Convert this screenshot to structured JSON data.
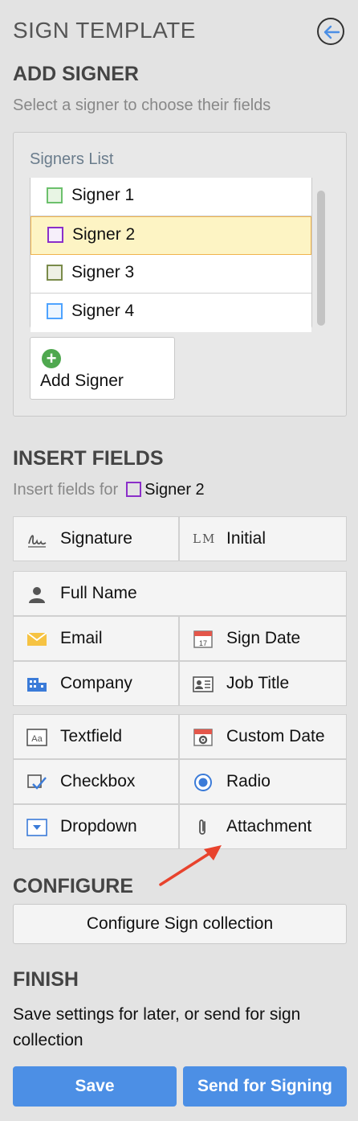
{
  "header": {
    "title": "SIGN TEMPLATE",
    "back_icon": "back-arrow-icon"
  },
  "add_signer": {
    "heading": "ADD SIGNER",
    "subtitle": "Select a signer to choose their fields",
    "list_label": "Signers List",
    "signers": [
      {
        "name": "Signer 1",
        "color": "#6cc06c"
      },
      {
        "name": "Signer 2",
        "color": "#8b2fc9",
        "selected": true
      },
      {
        "name": "Signer 3",
        "color": "#7a8b4a"
      },
      {
        "name": "Signer 4",
        "color": "#4ea3ff"
      }
    ],
    "add_button_label": "Add Signer"
  },
  "insert_fields": {
    "heading": "INSERT FIELDS",
    "insert_for_prefix": "Insert fields for",
    "current_signer": "Signer 2",
    "fields": {
      "signature": "Signature",
      "initial": "Initial",
      "full_name": "Full Name",
      "email": "Email",
      "sign_date": "Sign Date",
      "company": "Company",
      "job_title": "Job Title",
      "textfield": "Textfield",
      "custom_date": "Custom Date",
      "checkbox": "Checkbox",
      "radio": "Radio",
      "dropdown": "Dropdown",
      "attachment": "Attachment"
    },
    "initial_icon_text": "LM",
    "calendar_day": "17"
  },
  "configure": {
    "heading": "CONFIGURE",
    "button_label": "Configure Sign collection"
  },
  "finish": {
    "heading": "FINISH",
    "text": "Save settings for later, or send for sign collection",
    "save_label": "Save",
    "send_label": "Send for Signing"
  },
  "colors": {
    "accent": "#4c8fe5",
    "selected_bg": "#fdf4c4",
    "annotation_arrow": "#e8432d"
  }
}
